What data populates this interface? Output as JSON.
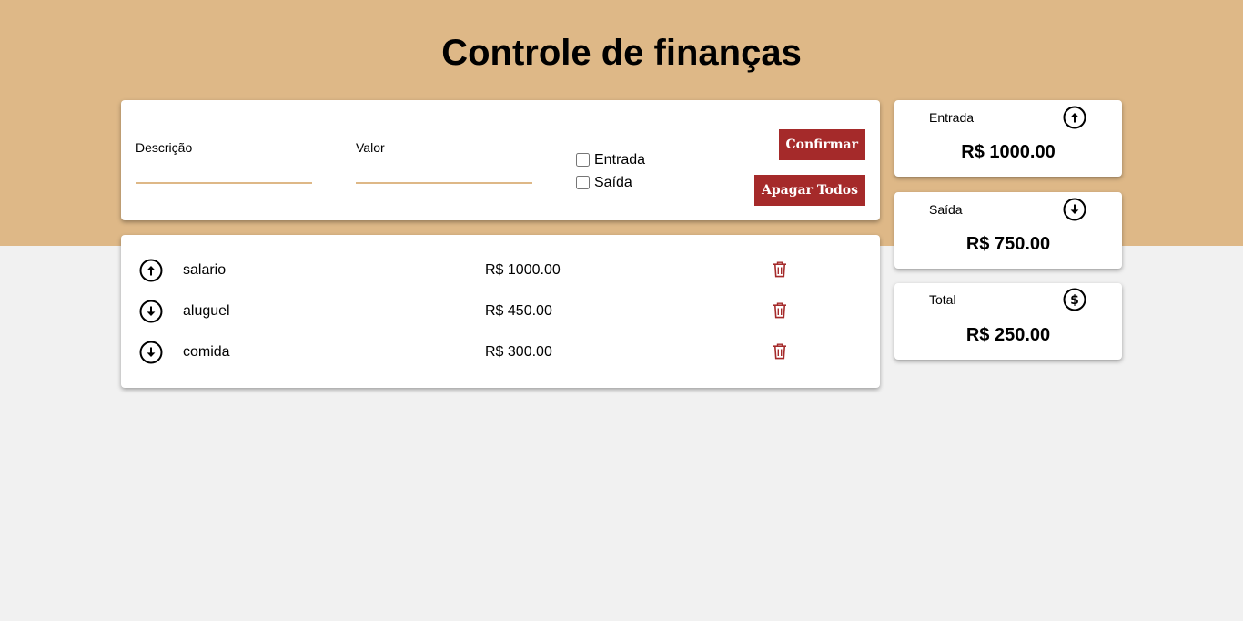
{
  "header": {
    "title": "Controle de finanças"
  },
  "form": {
    "description_label": "Descrição",
    "description_value": "",
    "value_label": "Valor",
    "value_value": "",
    "entrada_label": "Entrada",
    "saida_label": "Saída",
    "entrada_checked": false,
    "saida_checked": false,
    "confirm_label": "Confirmar",
    "clear_all_label": "Apagar Todos"
  },
  "transactions": [
    {
      "direction_icon": "arrow-up-circle-icon",
      "description": "salario",
      "value": "R$ 1000.00",
      "delete_icon": "trash-icon"
    },
    {
      "direction_icon": "arrow-down-circle-icon",
      "description": "aluguel",
      "value": "R$ 450.00",
      "delete_icon": "trash-icon"
    },
    {
      "direction_icon": "arrow-down-circle-icon",
      "description": "comida",
      "value": "R$ 300.00",
      "delete_icon": "trash-icon"
    }
  ],
  "summary": {
    "entrada": {
      "label": "Entrada",
      "value": "R$ 1000.00",
      "icon": "arrow-up-circle-icon"
    },
    "saida": {
      "label": "Saída",
      "value": "R$ 750.00",
      "icon": "arrow-down-circle-icon"
    },
    "total": {
      "label": "Total",
      "value": "R$ 250.00",
      "icon": "dollar-circle-icon"
    }
  },
  "colors": {
    "header_band": "#deb887",
    "page_background": "#f1f1f1",
    "button": "#a52a2a",
    "delete_icon": "#a52a2a"
  }
}
